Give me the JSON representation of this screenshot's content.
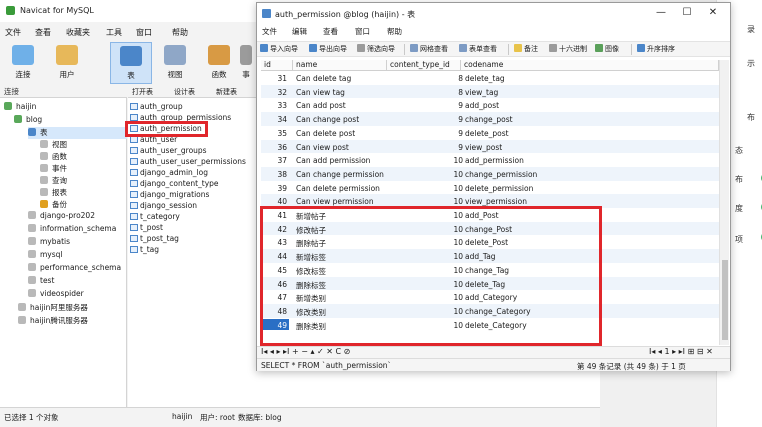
{
  "bg_window": {
    "title": "Navicat for MySQL",
    "menu": [
      "文件",
      "查看",
      "收藏夹",
      "工具",
      "窗口",
      "帮助"
    ],
    "toolbar": [
      "连接",
      "用户",
      "表",
      "视图",
      "函数",
      "事"
    ],
    "section_label": "连接",
    "mid_toolbar": [
      "打开表",
      "设计表",
      "新建表"
    ],
    "tree": {
      "connection": "haijin",
      "database": "blog",
      "items": [
        "表",
        "视图",
        "函数",
        "事件",
        "查询",
        "报表",
        "备份"
      ],
      "other_dbs": [
        "django-pro202",
        "information_schema",
        "mybatis",
        "mysql",
        "performance_schema",
        "test",
        "videospider"
      ],
      "other_conns": [
        "haijin阿里服务器",
        "haijin腾讯服务器"
      ]
    },
    "tables": [
      "auth_group",
      "auth_group_permissions",
      "auth_permission",
      "auth_user",
      "auth_user_groups",
      "auth_user_user_permissions",
      "django_admin_log",
      "django_content_type",
      "django_migrations",
      "django_session",
      "t_category",
      "t_post",
      "t_post_tag",
      "t_tag"
    ],
    "status": {
      "selected": "已选择 1 个对象",
      "conn": "haijin",
      "user": "用户: root",
      "db": "数据库: blog"
    }
  },
  "right_bg": {
    "labels": [
      "录",
      "示",
      "布",
      "态",
      "布",
      "度",
      "项"
    ]
  },
  "fg_window": {
    "title": "auth_permission @blog (haijin) - 表",
    "win_buttons": [
      "—",
      "☐",
      "✕"
    ],
    "menu": [
      "文件",
      "编辑",
      "查看",
      "窗口",
      "帮助"
    ],
    "toolbar": [
      "导入向导",
      "导出向导",
      "筛选向导",
      "网格查看",
      "表单查看",
      "备注",
      "十六进制",
      "图像",
      "升序排序"
    ],
    "columns": [
      "id",
      "name",
      "content_type_id",
      "codename"
    ],
    "rows": [
      {
        "id": "31",
        "name": "Can delete tag",
        "content_type_id": "8",
        "codename": "delete_tag"
      },
      {
        "id": "32",
        "name": "Can view tag",
        "content_type_id": "8",
        "codename": "view_tag"
      },
      {
        "id": "33",
        "name": "Can add post",
        "content_type_id": "9",
        "codename": "add_post"
      },
      {
        "id": "34",
        "name": "Can change post",
        "content_type_id": "9",
        "codename": "change_post"
      },
      {
        "id": "35",
        "name": "Can delete post",
        "content_type_id": "9",
        "codename": "delete_post"
      },
      {
        "id": "36",
        "name": "Can view post",
        "content_type_id": "9",
        "codename": "view_post"
      },
      {
        "id": "37",
        "name": "Can add permission",
        "content_type_id": "10",
        "codename": "add_permission"
      },
      {
        "id": "38",
        "name": "Can change permission",
        "content_type_id": "10",
        "codename": "change_permission"
      },
      {
        "id": "39",
        "name": "Can delete permission",
        "content_type_id": "10",
        "codename": "delete_permission"
      },
      {
        "id": "40",
        "name": "Can view permission",
        "content_type_id": "10",
        "codename": "view_permission"
      },
      {
        "id": "41",
        "name": "新增帖子",
        "content_type_id": "10",
        "codename": "add_Post"
      },
      {
        "id": "42",
        "name": "修改帖子",
        "content_type_id": "10",
        "codename": "change_Post"
      },
      {
        "id": "43",
        "name": "删除帖子",
        "content_type_id": "10",
        "codename": "delete_Post"
      },
      {
        "id": "44",
        "name": "新增标签",
        "content_type_id": "10",
        "codename": "add_Tag"
      },
      {
        "id": "45",
        "name": "修改标签",
        "content_type_id": "10",
        "codename": "change_Tag"
      },
      {
        "id": "46",
        "name": "删除标签",
        "content_type_id": "10",
        "codename": "delete_Tag"
      },
      {
        "id": "47",
        "name": "新增类别",
        "content_type_id": "10",
        "codename": "add_Category"
      },
      {
        "id": "48",
        "name": "修改类别",
        "content_type_id": "10",
        "codename": "change_Category"
      },
      {
        "id": "49",
        "name": "删除类别",
        "content_type_id": "10",
        "codename": "delete_Category"
      }
    ],
    "nav_left": "I◂ ◂ ▸ ▸I + − ▴ ✓ ✕ C ⊘",
    "nav_right": "I◂ ◂ 1 ▸ ▸I ⊞ ⊟ ✕",
    "status_sql": "SELECT * FROM `auth_permission`",
    "status_rec": "第 49 条记录 (共 49 条) 于 1 页"
  }
}
